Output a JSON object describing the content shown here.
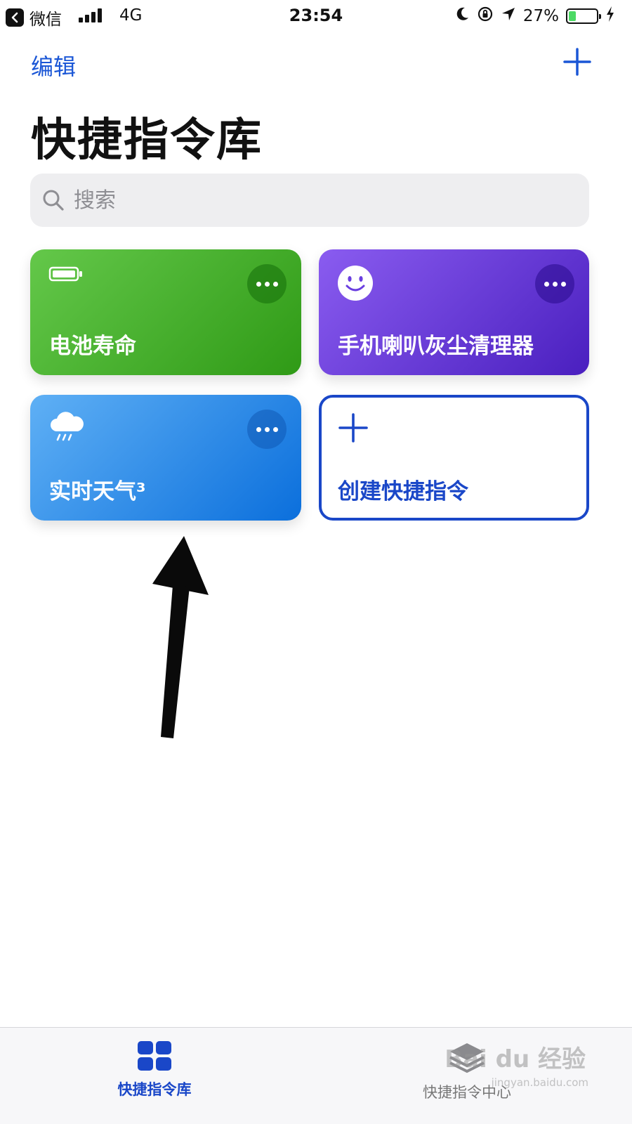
{
  "status_bar": {
    "back_app": "微信",
    "carrier": "4G",
    "time": "23:54",
    "battery_percent": "27%",
    "battery_level": 0.27
  },
  "nav": {
    "edit_label": "编辑"
  },
  "page_title": "快捷指令库",
  "search": {
    "placeholder": "搜索"
  },
  "shortcuts": [
    {
      "label": "电池寿命",
      "icon": "battery-icon",
      "color": "#4cb02f"
    },
    {
      "label": "手机喇叭灰尘清理器",
      "icon": "smiley-icon",
      "color": "#6a3ee0"
    },
    {
      "label": "实时天气³",
      "icon": "rain-cloud-icon",
      "color": "#2a8ae8"
    }
  ],
  "create_shortcut": {
    "label": "创建快捷指令",
    "color": "#1a47c8"
  },
  "tabs": [
    {
      "label": "快捷指令库",
      "active": true
    },
    {
      "label": "快捷指令中心",
      "active": false
    }
  ],
  "watermark": {
    "brand": "Bai du 经验",
    "url": "jingyan.baidu.com"
  }
}
